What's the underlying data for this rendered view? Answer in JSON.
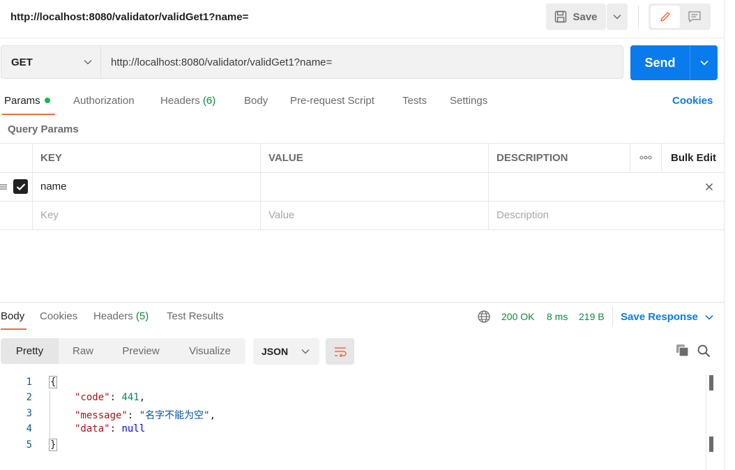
{
  "header": {
    "title_url": "http://localhost:8080/validator/validGet1?name=",
    "save_label": "Save"
  },
  "request": {
    "method": "GET",
    "url": "http://localhost:8080/validator/validGet1?name=",
    "send_label": "Send"
  },
  "tabs": {
    "params": "Params",
    "authorization": "Authorization",
    "headers": "Headers",
    "headers_count": "(6)",
    "body": "Body",
    "prerequest": "Pre-request Script",
    "tests": "Tests",
    "settings": "Settings",
    "cookies": "Cookies"
  },
  "query_params": {
    "section_title": "Query Params",
    "columns": [
      "KEY",
      "VALUE",
      "DESCRIPTION"
    ],
    "more_label": "ooo",
    "bulk_edit": "Bulk Edit",
    "rows": [
      {
        "key": "name",
        "value": "",
        "description": "",
        "checked": true
      }
    ],
    "placeholders": {
      "key": "Key",
      "value": "Value",
      "description": "Description"
    }
  },
  "response": {
    "tabs": {
      "body": "Body",
      "cookies": "Cookies",
      "headers": "Headers",
      "headers_count": "(5)",
      "test_results": "Test Results"
    },
    "status": "200 OK",
    "time": "8 ms",
    "size": "219 B",
    "save_response": "Save Response",
    "views": [
      "Pretty",
      "Raw",
      "Preview",
      "Visualize"
    ],
    "format": "JSON",
    "line_numbers": [
      "1",
      "2",
      "3",
      "4",
      "5"
    ],
    "code": {
      "open_brace": "{",
      "code_key": "\"code\"",
      "code_value": "441",
      "message_key": "\"message\"",
      "message_value": "\"名字不能为空\"",
      "data_key": "\"data\"",
      "data_value": "null",
      "close_brace": "}"
    }
  },
  "colors": {
    "accent_blue": "#097bed",
    "tab_underline": "#f26b3a",
    "status_green": "#0a8a3c"
  }
}
